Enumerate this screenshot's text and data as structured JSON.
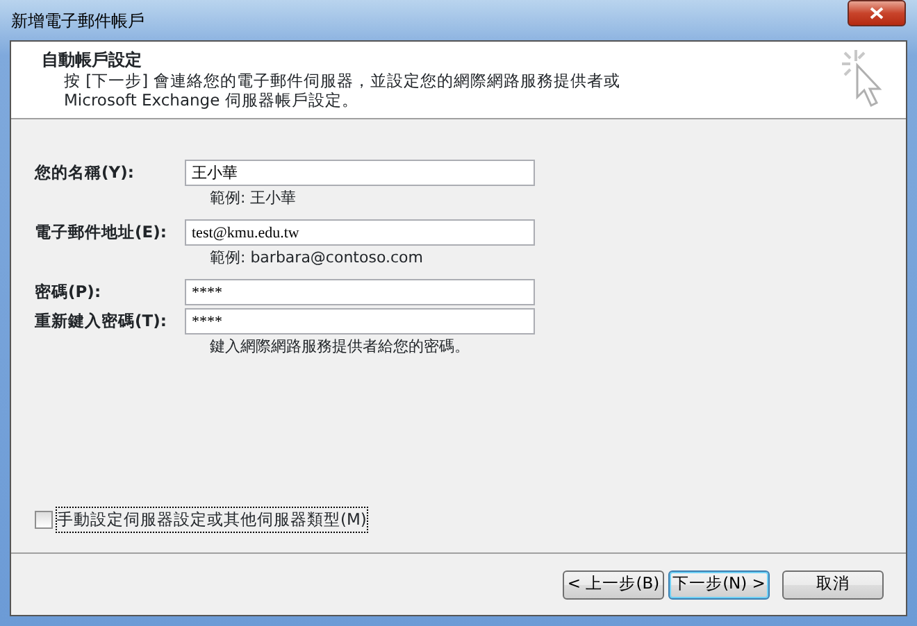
{
  "window": {
    "title": "新增電子郵件帳戶"
  },
  "header": {
    "title": "自動帳戶設定",
    "description": "按 [下一步] 會連絡您的電子郵件伺服器，並設定您的網際網路服務提供者或 Microsoft Exchange 伺服器帳戶設定。"
  },
  "fields": [
    {
      "label": "您的名稱(Y):",
      "value": "王小華",
      "hint": "範例: 王小華"
    },
    {
      "label": "電子郵件地址(E):",
      "value": "test@kmu.edu.tw",
      "hint": "範例: barbara@contoso.com"
    },
    {
      "label": "密碼(P):",
      "value": "****"
    },
    {
      "label": "重新鍵入密碼(T):",
      "value": "****",
      "hint": "鍵入網際網路服務提供者給您的密碼。"
    }
  ],
  "manual_setup": {
    "label": "手動設定伺服器設定或其他伺服器類型(M)",
    "checked": false
  },
  "buttons": [
    {
      "label": "< 上一步(B)",
      "default": false
    },
    {
      "label": "下一步(N) >",
      "default": true
    },
    {
      "label": "取消",
      "default": false
    }
  ]
}
